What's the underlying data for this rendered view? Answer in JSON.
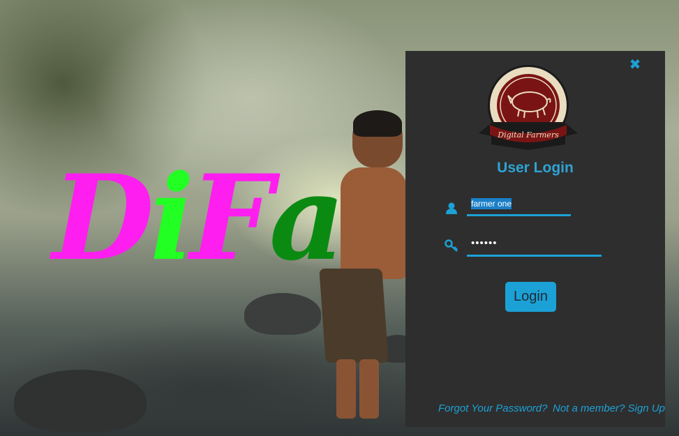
{
  "background": {
    "brand_text": [
      "D",
      "i",
      "F",
      "a"
    ],
    "brand_colors": [
      "#ff1ef0",
      "#22ff22",
      "#ff1ef0",
      "#0b8a12"
    ]
  },
  "login": {
    "close_icon": "close-icon",
    "badge": {
      "text": "Digital Farmers",
      "icon": "pig-icon",
      "ring_color": "#7a1414",
      "cream_color": "#e9dcc1"
    },
    "title": "User Login",
    "username": {
      "icon": "user-icon",
      "value": "farmer one"
    },
    "password": {
      "icon": "key-icon",
      "value": "••••••"
    },
    "login_label": "Login",
    "forgot_label": "Forgot Your Password?",
    "signup_label": "Not a member? Sign Up",
    "accent_color": "#1ca1d6",
    "panel_color": "#2e2e2e"
  }
}
